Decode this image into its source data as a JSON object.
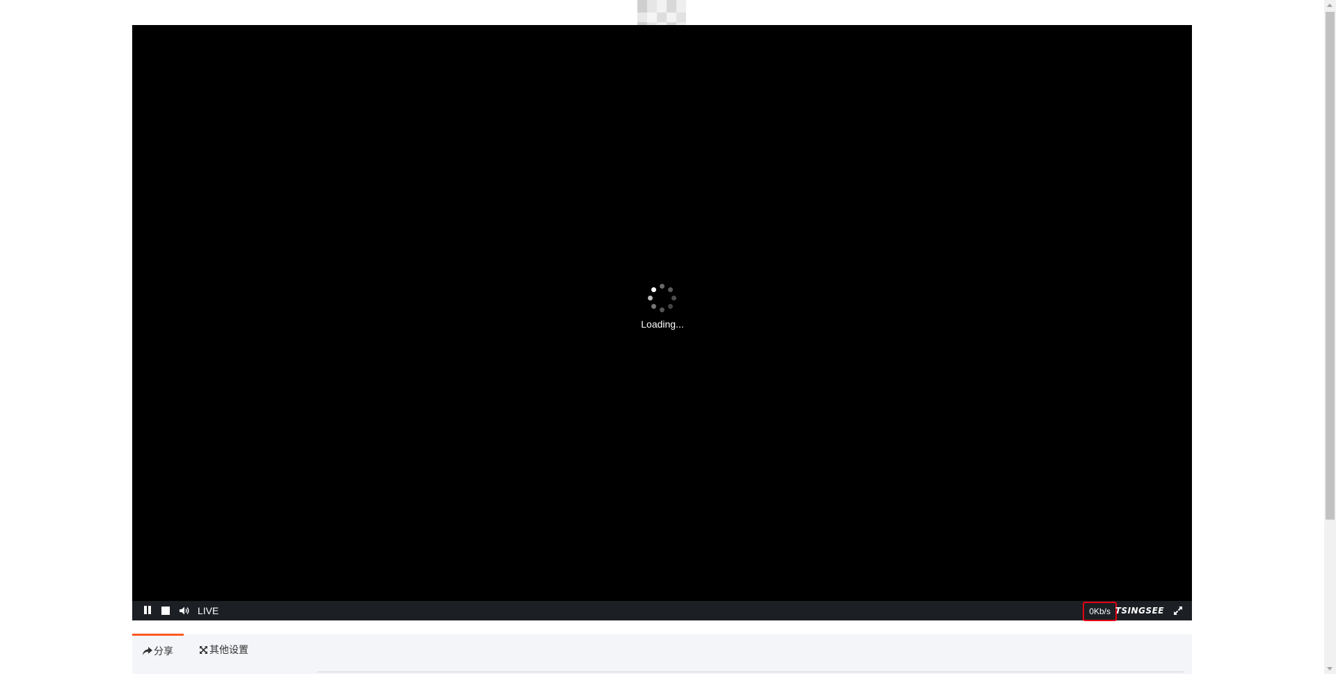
{
  "player": {
    "loading_text": "Loading...",
    "live_label": "LIVE",
    "bitrate": "0Kb/s",
    "brand": "TSINGSEE",
    "controls": {
      "pause_icon": "pause-icon",
      "stop_icon": "stop-icon",
      "volume_icon": "volume-icon",
      "fullscreen_icon": "fullscreen-icon"
    }
  },
  "tabs": [
    {
      "label": "分享",
      "icon": "share-icon",
      "active": true
    },
    {
      "label": "其他设置",
      "icon": "settings-icon",
      "active": false
    }
  ],
  "colors": {
    "accent": "#ff5722",
    "highlight_box": "#e60012",
    "controlbar": "#1c1f24",
    "video_bg": "#000000",
    "tabs_bg": "#f4f5f8"
  }
}
